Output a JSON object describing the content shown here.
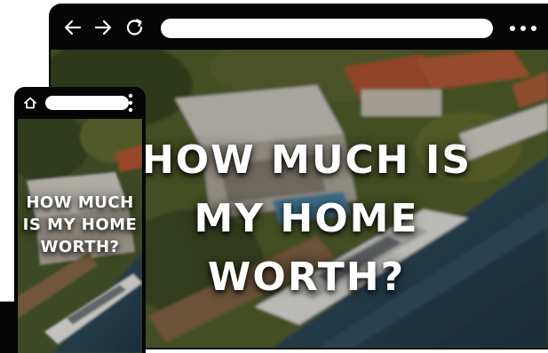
{
  "desktop_browser": {
    "headline": "HOW MUCH IS MY HOME WORTH?",
    "icons": [
      "back-arrow-icon",
      "forward-arrow-icon",
      "reload-icon",
      "more-horizontal-icon"
    ]
  },
  "mobile_browser": {
    "headline": "HOW MUCH IS MY HOME WORTH?",
    "icons": [
      "home-icon",
      "more-vertical-icon"
    ]
  },
  "colors": {
    "frame": "#050505",
    "urlbar": "#ffffff",
    "headline_text": "#ffffff",
    "water": "#2d4a5e",
    "foliage": "#4a5a2a",
    "roof_red": "#b4512f",
    "roof_white": "#d9d6cf"
  }
}
